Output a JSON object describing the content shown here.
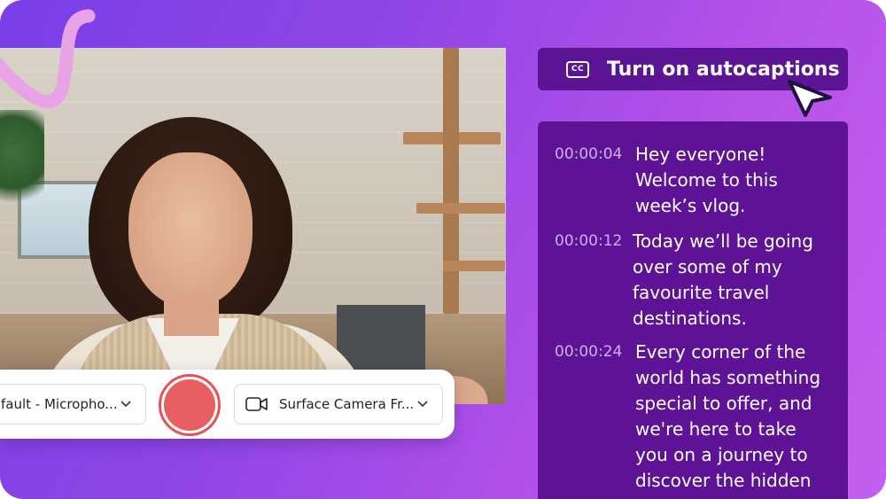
{
  "controls": {
    "microphone_label": "fault - Micropho...",
    "camera_label": "Surface Camera Fr..."
  },
  "autocaptions": {
    "label": "Turn on autocaptions",
    "icon_text": "CC"
  },
  "transcript": {
    "entries": [
      {
        "time": "00:00:04",
        "text": "Hey everyone!\nWelcome to this\nweek’s vlog."
      },
      {
        "time": "00:00:12",
        "text": "Today we’ll be going\nover some of my\nfavourite travel\ndestinations."
      },
      {
        "time": "00:00:24",
        "text": "Every corner of the\nworld has something\nspecial to offer, and\nwe're here to take\nyou on a journey to\ndiscover the hidden"
      }
    ]
  },
  "icons": {
    "closed_captions": "cc-icon",
    "camera": "video-camera-icon",
    "chevron": "chevron-down-icon",
    "cursor": "mouse-pointer-icon"
  },
  "colors": {
    "background_start": "#7a3fe8",
    "background_end": "#c35ff0",
    "panel": "#5e1396",
    "record": "#e95e60",
    "timestamp": "#cdb0f0"
  }
}
